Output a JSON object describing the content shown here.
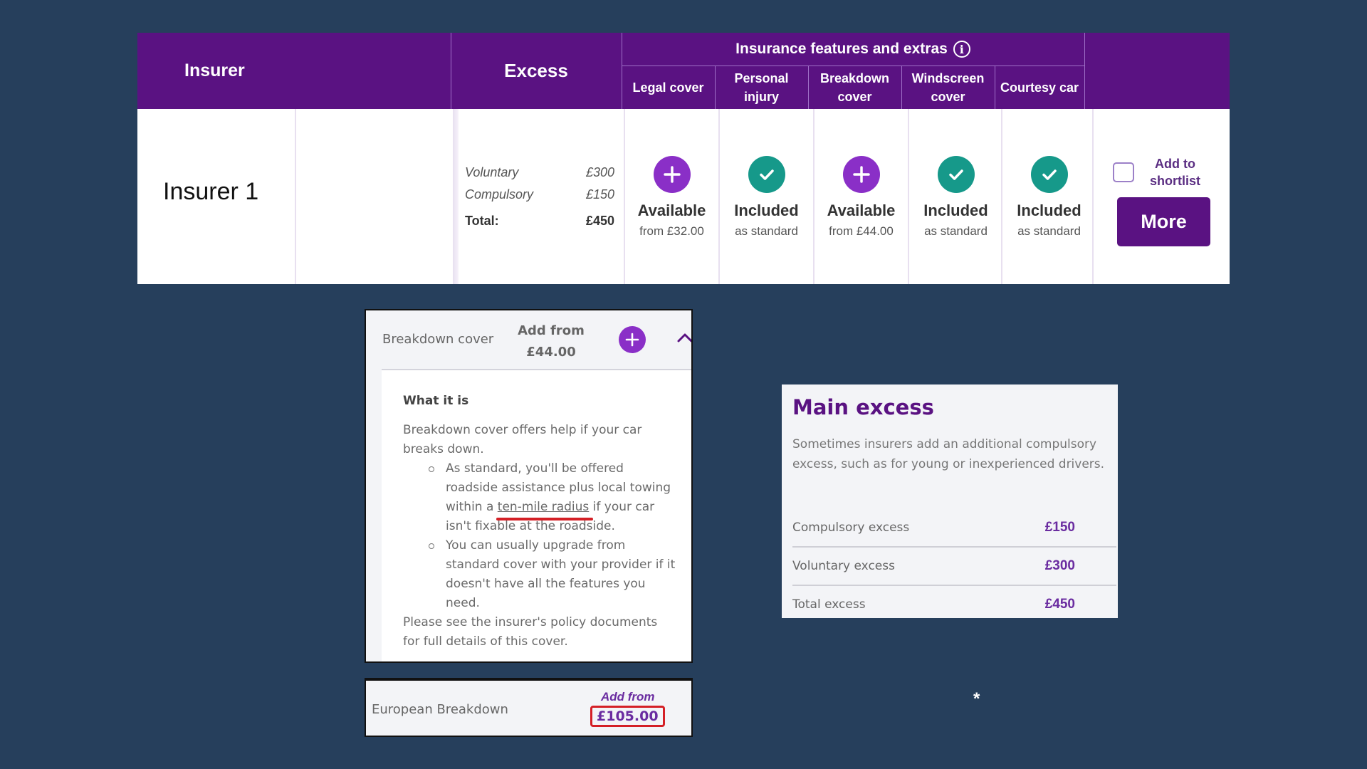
{
  "table": {
    "headers": {
      "insurer": "Insurer",
      "excess": "Excess",
      "features_group": "Insurance features and extras",
      "features_info_icon": "info-icon",
      "features": [
        {
          "line1": "Legal cover",
          "line2": ""
        },
        {
          "line1": "Personal",
          "line2": "injury"
        },
        {
          "line1": "Breakdown",
          "line2": "cover"
        },
        {
          "line1": "Windscreen",
          "line2": "cover"
        },
        {
          "line1": "Courtesy car",
          "line2": ""
        }
      ]
    },
    "row": {
      "insurer_name": "Insurer 1",
      "excess": {
        "voluntary_label": "Voluntary",
        "voluntary_value": "£300",
        "compulsory_label": "Compulsory",
        "compulsory_value": "£150",
        "total_label": "Total:",
        "total_value": "£450"
      },
      "features": [
        {
          "icon": "plus-icon",
          "status": "Available",
          "sub": "from £32.00"
        },
        {
          "icon": "check-icon",
          "status": "Included",
          "sub": "as standard"
        },
        {
          "icon": "plus-icon",
          "status": "Available",
          "sub": "from £44.00"
        },
        {
          "icon": "check-icon",
          "status": "Included",
          "sub": "as standard"
        },
        {
          "icon": "check-icon",
          "status": "Included",
          "sub": "as standard"
        }
      ],
      "shortlist_label_1": "Add to",
      "shortlist_label_2": "shortlist",
      "shortlist_checked": false,
      "more_button": "More"
    }
  },
  "breakdown_panel": {
    "title": "Breakdown cover",
    "add_from_label": "Add from",
    "add_from_price": "£44.00",
    "section_heading": "What it is",
    "intro": "Breakdown cover offers help if your car breaks down.",
    "bullet1_pre": "As standard, you'll be offered roadside assistance plus local towing within a ",
    "bullet1_link": "ten-mile radius",
    "bullet1_post": " if your car isn't fixable at the roadside.",
    "bullet2": "You can usually upgrade from standard cover with your provider if it doesn't have all the features you need.",
    "footer": "Please see the insurer's policy documents for full details of this cover."
  },
  "european_breakdown": {
    "title": "European Breakdown",
    "add_from_label": "Add from",
    "price": "£105.00"
  },
  "main_excess": {
    "title": "Main excess",
    "description": "Sometimes insurers add an additional compulsory excess, such as for young or inexperienced drivers.",
    "rows": [
      {
        "label": "Compulsory excess",
        "value": "£150"
      },
      {
        "label": "Voluntary excess",
        "value": "£300"
      },
      {
        "label": "Total excess",
        "value": "£450"
      }
    ]
  },
  "annotation": "*",
  "colors": {
    "background": "#263f5c",
    "brand_purple": "#5a1282",
    "available_purple": "#8a2fc7",
    "included_teal": "#16998a",
    "highlight_red": "#d42026"
  }
}
